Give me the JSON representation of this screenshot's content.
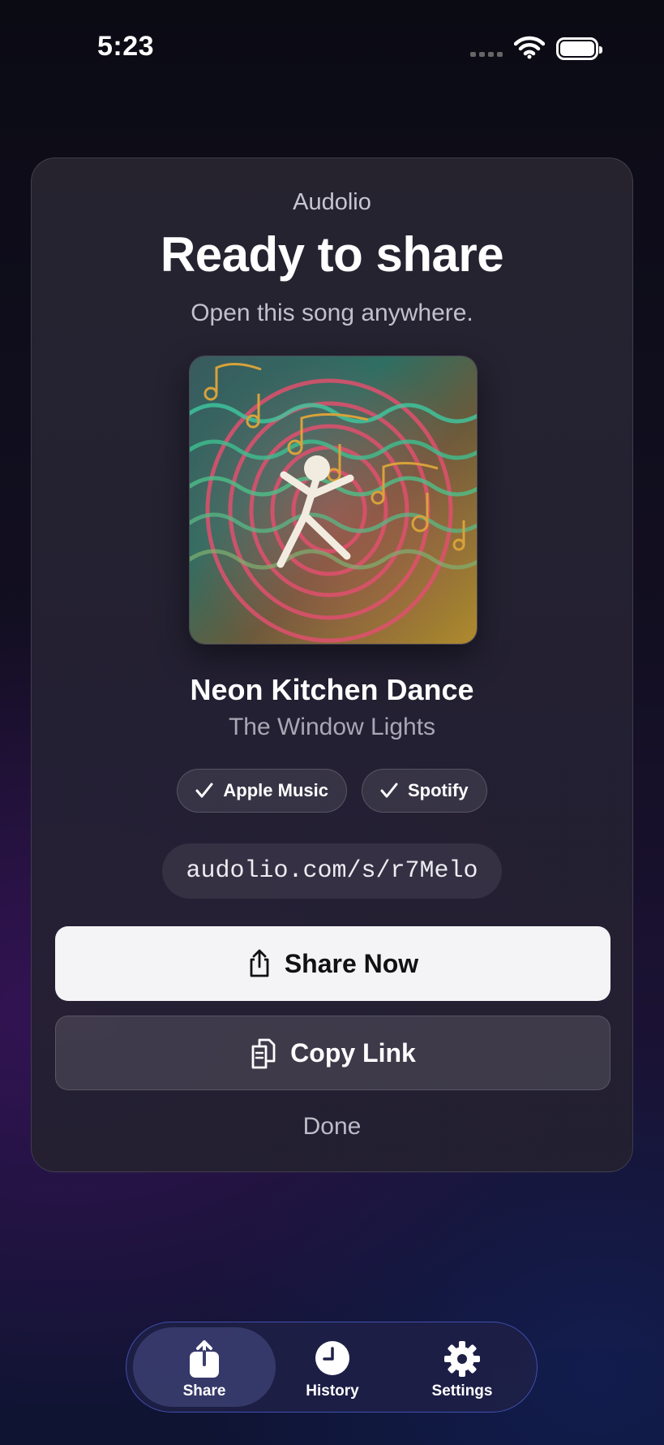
{
  "status_bar": {
    "time": "5:23"
  },
  "card": {
    "app_name": "Audolio",
    "title": "Ready to share",
    "subtitle": "Open this song anywhere.",
    "song_title": "Neon Kitchen Dance",
    "artist": "The Window Lights",
    "services": [
      "Apple Music",
      "Spotify"
    ],
    "link": "audolio.com/s/r7Melo",
    "share_label": "Share Now",
    "copy_label": "Copy Link",
    "done_label": "Done"
  },
  "tab_bar": {
    "tabs": [
      {
        "label": "Share",
        "icon": "share-icon",
        "active": true
      },
      {
        "label": "History",
        "icon": "clock-icon",
        "active": false
      },
      {
        "label": "Settings",
        "icon": "gear-icon",
        "active": false
      }
    ]
  },
  "colors": {
    "primary_button": "#f4f4f7",
    "tab_bar_border": "#5064dc"
  }
}
